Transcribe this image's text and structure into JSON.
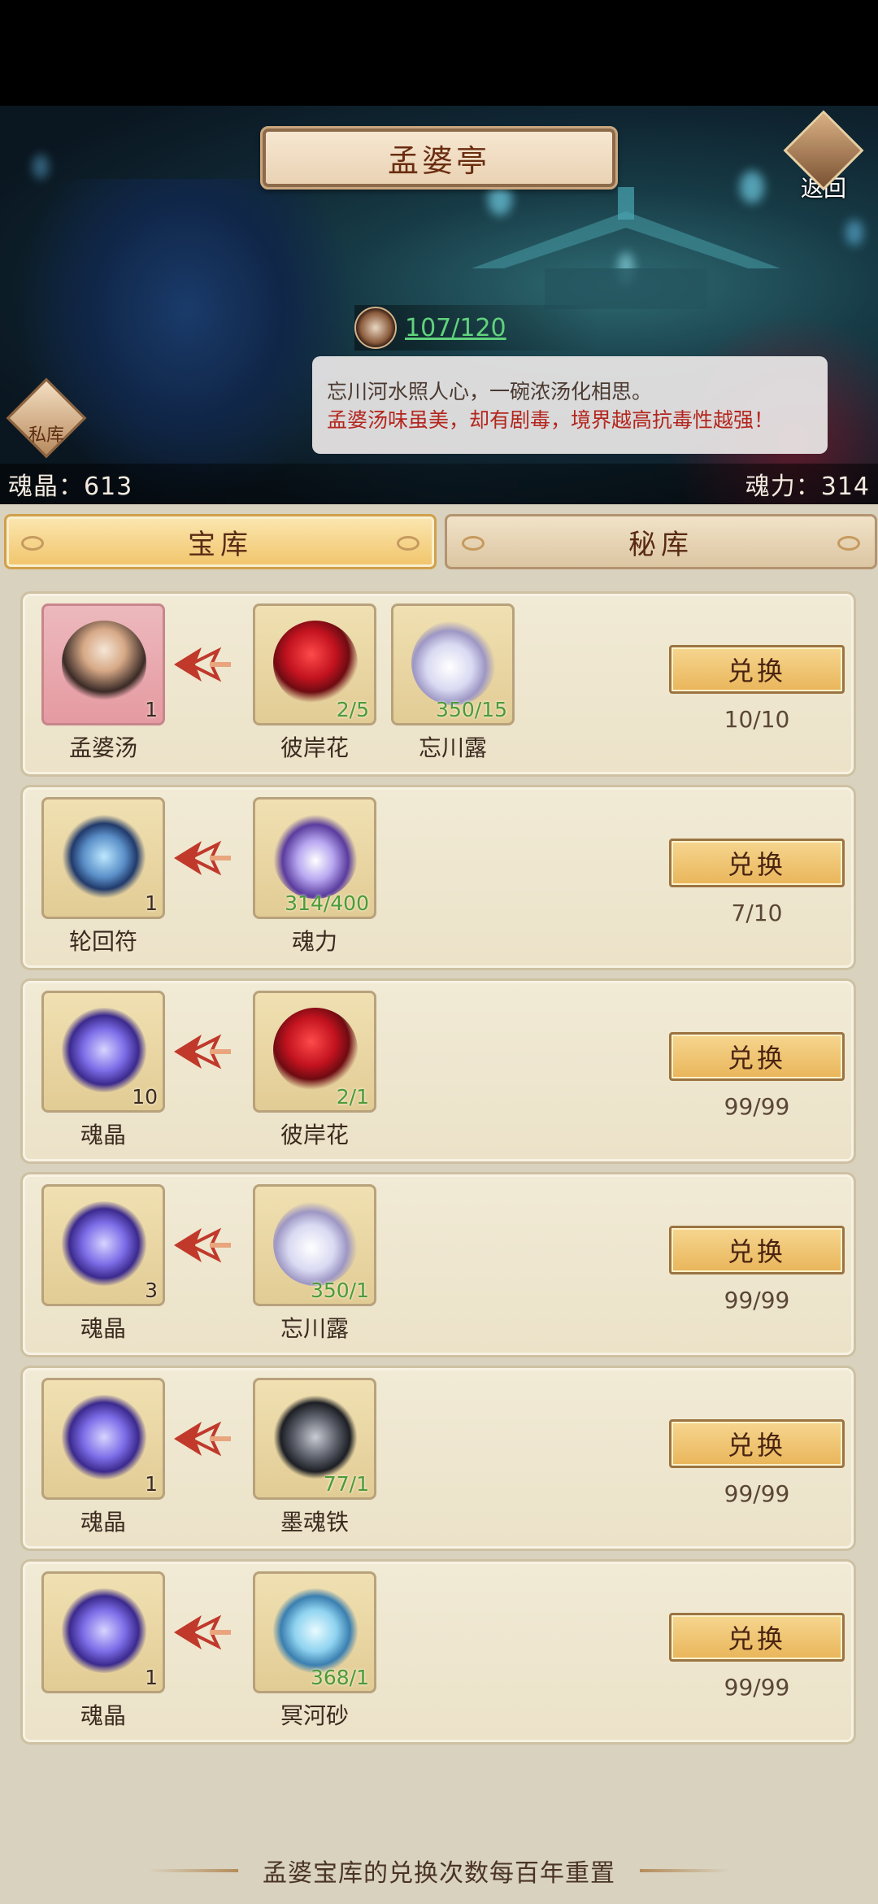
{
  "header": {
    "title": "孟婆亭",
    "back_label": "返回",
    "vault_label": "私库",
    "counter": "107/120",
    "dialog_line1": "忘川河水照人心，一碗浓汤化相思。",
    "dialog_line2": "孟婆汤味虽美，却有剧毒，境界越高抗毒性越强！",
    "soul_crystal": "魂晶：613",
    "soul_power": "魂力：314"
  },
  "tabs": [
    {
      "label": "宝库",
      "active": true
    },
    {
      "label": "秘库",
      "active": false
    }
  ],
  "exchange_label": "兑换",
  "rows": [
    {
      "result": {
        "name": "孟婆汤",
        "count": "1",
        "icon": "soup-bowl-icon"
      },
      "costs": [
        {
          "name": "彼岸花",
          "count": "2/5",
          "icon": "red-spider-lily-icon"
        },
        {
          "name": "忘川露",
          "count": "350/15",
          "icon": "dew-flask-icon"
        }
      ],
      "limit": "10/10"
    },
    {
      "result": {
        "name": "轮回符",
        "count": "1",
        "icon": "talisman-icon"
      },
      "costs": [
        {
          "name": "魂力",
          "count": "314/400",
          "icon": "soul-flame-icon"
        }
      ],
      "limit": "7/10"
    },
    {
      "result": {
        "name": "魂晶",
        "count": "10",
        "icon": "soul-crystal-icon"
      },
      "costs": [
        {
          "name": "彼岸花",
          "count": "2/1",
          "icon": "red-spider-lily-icon"
        }
      ],
      "limit": "99/99"
    },
    {
      "result": {
        "name": "魂晶",
        "count": "3",
        "icon": "soul-crystal-icon"
      },
      "costs": [
        {
          "name": "忘川露",
          "count": "350/1",
          "icon": "dew-flask-icon"
        }
      ],
      "limit": "99/99"
    },
    {
      "result": {
        "name": "魂晶",
        "count": "1",
        "icon": "soul-crystal-icon"
      },
      "costs": [
        {
          "name": "墨魂铁",
          "count": "77/1",
          "icon": "ink-iron-ore-icon"
        }
      ],
      "limit": "99/99"
    },
    {
      "result": {
        "name": "魂晶",
        "count": "1",
        "icon": "soul-crystal-icon"
      },
      "costs": [
        {
          "name": "冥河砂",
          "count": "368/1",
          "icon": "styx-sand-icon"
        }
      ],
      "limit": "99/99"
    }
  ],
  "footer": "孟婆宝库的兑换次数每百年重置",
  "colors": {
    "accent_gold": "#f1c46a",
    "counter_green": "#61d27d",
    "warning_red": "#b3261e",
    "cost_count_green": "#4b9b35"
  }
}
